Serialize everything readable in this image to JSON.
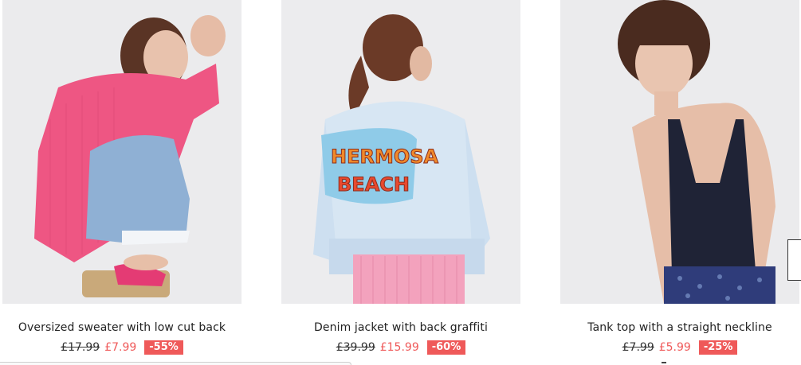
{
  "products": [
    {
      "title": "Oversized sweater with low cut back",
      "old_price": "£17.99",
      "new_price": "£7.99",
      "discount": "-55%"
    },
    {
      "title": "Denim jacket with back graffiti",
      "old_price": "£39.99",
      "new_price": "£15.99",
      "discount": "-60%"
    },
    {
      "title": "Tank top with a straight neckline",
      "old_price": "£7.99",
      "new_price": "£5.99",
      "discount": "-25%"
    }
  ],
  "colors": {
    "sale": "#ef5959",
    "photo_bg": "#ececee"
  }
}
